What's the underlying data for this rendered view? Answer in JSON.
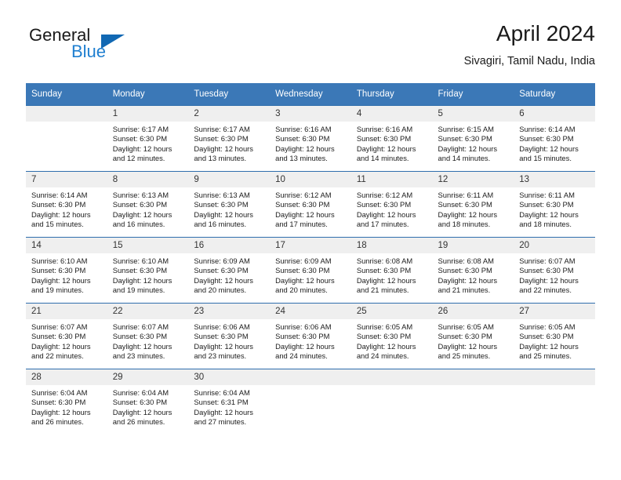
{
  "brand": {
    "name_part1": "General",
    "name_part2": "Blue",
    "triangle_color": "#1168b3",
    "blue_color": "#1f7fd0"
  },
  "header": {
    "title": "April 2024",
    "subtitle": "Sivagiri, Tamil Nadu, India"
  },
  "theme": {
    "header_bg": "#3b78b7",
    "daynum_bg": "#efefef",
    "grid_line": "#2f6ead",
    "text": "#1a1a1a"
  },
  "weekday_headers": [
    "Sunday",
    "Monday",
    "Tuesday",
    "Wednesday",
    "Thursday",
    "Friday",
    "Saturday"
  ],
  "weeks": [
    [
      {
        "day": "",
        "sunrise": "",
        "sunset": "",
        "daylight": "",
        "empty": true
      },
      {
        "day": "1",
        "sunrise": "Sunrise: 6:17 AM",
        "sunset": "Sunset: 6:30 PM",
        "daylight": "Daylight: 12 hours and 12 minutes."
      },
      {
        "day": "2",
        "sunrise": "Sunrise: 6:17 AM",
        "sunset": "Sunset: 6:30 PM",
        "daylight": "Daylight: 12 hours and 13 minutes."
      },
      {
        "day": "3",
        "sunrise": "Sunrise: 6:16 AM",
        "sunset": "Sunset: 6:30 PM",
        "daylight": "Daylight: 12 hours and 13 minutes."
      },
      {
        "day": "4",
        "sunrise": "Sunrise: 6:16 AM",
        "sunset": "Sunset: 6:30 PM",
        "daylight": "Daylight: 12 hours and 14 minutes."
      },
      {
        "day": "5",
        "sunrise": "Sunrise: 6:15 AM",
        "sunset": "Sunset: 6:30 PM",
        "daylight": "Daylight: 12 hours and 14 minutes."
      },
      {
        "day": "6",
        "sunrise": "Sunrise: 6:14 AM",
        "sunset": "Sunset: 6:30 PM",
        "daylight": "Daylight: 12 hours and 15 minutes."
      }
    ],
    [
      {
        "day": "7",
        "sunrise": "Sunrise: 6:14 AM",
        "sunset": "Sunset: 6:30 PM",
        "daylight": "Daylight: 12 hours and 15 minutes."
      },
      {
        "day": "8",
        "sunrise": "Sunrise: 6:13 AM",
        "sunset": "Sunset: 6:30 PM",
        "daylight": "Daylight: 12 hours and 16 minutes."
      },
      {
        "day": "9",
        "sunrise": "Sunrise: 6:13 AM",
        "sunset": "Sunset: 6:30 PM",
        "daylight": "Daylight: 12 hours and 16 minutes."
      },
      {
        "day": "10",
        "sunrise": "Sunrise: 6:12 AM",
        "sunset": "Sunset: 6:30 PM",
        "daylight": "Daylight: 12 hours and 17 minutes."
      },
      {
        "day": "11",
        "sunrise": "Sunrise: 6:12 AM",
        "sunset": "Sunset: 6:30 PM",
        "daylight": "Daylight: 12 hours and 17 minutes."
      },
      {
        "day": "12",
        "sunrise": "Sunrise: 6:11 AM",
        "sunset": "Sunset: 6:30 PM",
        "daylight": "Daylight: 12 hours and 18 minutes."
      },
      {
        "day": "13",
        "sunrise": "Sunrise: 6:11 AM",
        "sunset": "Sunset: 6:30 PM",
        "daylight": "Daylight: 12 hours and 18 minutes."
      }
    ],
    [
      {
        "day": "14",
        "sunrise": "Sunrise: 6:10 AM",
        "sunset": "Sunset: 6:30 PM",
        "daylight": "Daylight: 12 hours and 19 minutes."
      },
      {
        "day": "15",
        "sunrise": "Sunrise: 6:10 AM",
        "sunset": "Sunset: 6:30 PM",
        "daylight": "Daylight: 12 hours and 19 minutes."
      },
      {
        "day": "16",
        "sunrise": "Sunrise: 6:09 AM",
        "sunset": "Sunset: 6:30 PM",
        "daylight": "Daylight: 12 hours and 20 minutes."
      },
      {
        "day": "17",
        "sunrise": "Sunrise: 6:09 AM",
        "sunset": "Sunset: 6:30 PM",
        "daylight": "Daylight: 12 hours and 20 minutes."
      },
      {
        "day": "18",
        "sunrise": "Sunrise: 6:08 AM",
        "sunset": "Sunset: 6:30 PM",
        "daylight": "Daylight: 12 hours and 21 minutes."
      },
      {
        "day": "19",
        "sunrise": "Sunrise: 6:08 AM",
        "sunset": "Sunset: 6:30 PM",
        "daylight": "Daylight: 12 hours and 21 minutes."
      },
      {
        "day": "20",
        "sunrise": "Sunrise: 6:07 AM",
        "sunset": "Sunset: 6:30 PM",
        "daylight": "Daylight: 12 hours and 22 minutes."
      }
    ],
    [
      {
        "day": "21",
        "sunrise": "Sunrise: 6:07 AM",
        "sunset": "Sunset: 6:30 PM",
        "daylight": "Daylight: 12 hours and 22 minutes."
      },
      {
        "day": "22",
        "sunrise": "Sunrise: 6:07 AM",
        "sunset": "Sunset: 6:30 PM",
        "daylight": "Daylight: 12 hours and 23 minutes."
      },
      {
        "day": "23",
        "sunrise": "Sunrise: 6:06 AM",
        "sunset": "Sunset: 6:30 PM",
        "daylight": "Daylight: 12 hours and 23 minutes."
      },
      {
        "day": "24",
        "sunrise": "Sunrise: 6:06 AM",
        "sunset": "Sunset: 6:30 PM",
        "daylight": "Daylight: 12 hours and 24 minutes."
      },
      {
        "day": "25",
        "sunrise": "Sunrise: 6:05 AM",
        "sunset": "Sunset: 6:30 PM",
        "daylight": "Daylight: 12 hours and 24 minutes."
      },
      {
        "day": "26",
        "sunrise": "Sunrise: 6:05 AM",
        "sunset": "Sunset: 6:30 PM",
        "daylight": "Daylight: 12 hours and 25 minutes."
      },
      {
        "day": "27",
        "sunrise": "Sunrise: 6:05 AM",
        "sunset": "Sunset: 6:30 PM",
        "daylight": "Daylight: 12 hours and 25 minutes."
      }
    ],
    [
      {
        "day": "28",
        "sunrise": "Sunrise: 6:04 AM",
        "sunset": "Sunset: 6:30 PM",
        "daylight": "Daylight: 12 hours and 26 minutes."
      },
      {
        "day": "29",
        "sunrise": "Sunrise: 6:04 AM",
        "sunset": "Sunset: 6:30 PM",
        "daylight": "Daylight: 12 hours and 26 minutes."
      },
      {
        "day": "30",
        "sunrise": "Sunrise: 6:04 AM",
        "sunset": "Sunset: 6:31 PM",
        "daylight": "Daylight: 12 hours and 27 minutes."
      },
      {
        "day": "",
        "sunrise": "",
        "sunset": "",
        "daylight": "",
        "empty": true
      },
      {
        "day": "",
        "sunrise": "",
        "sunset": "",
        "daylight": "",
        "empty": true
      },
      {
        "day": "",
        "sunrise": "",
        "sunset": "",
        "daylight": "",
        "empty": true
      },
      {
        "day": "",
        "sunrise": "",
        "sunset": "",
        "daylight": "",
        "empty": true
      }
    ]
  ]
}
